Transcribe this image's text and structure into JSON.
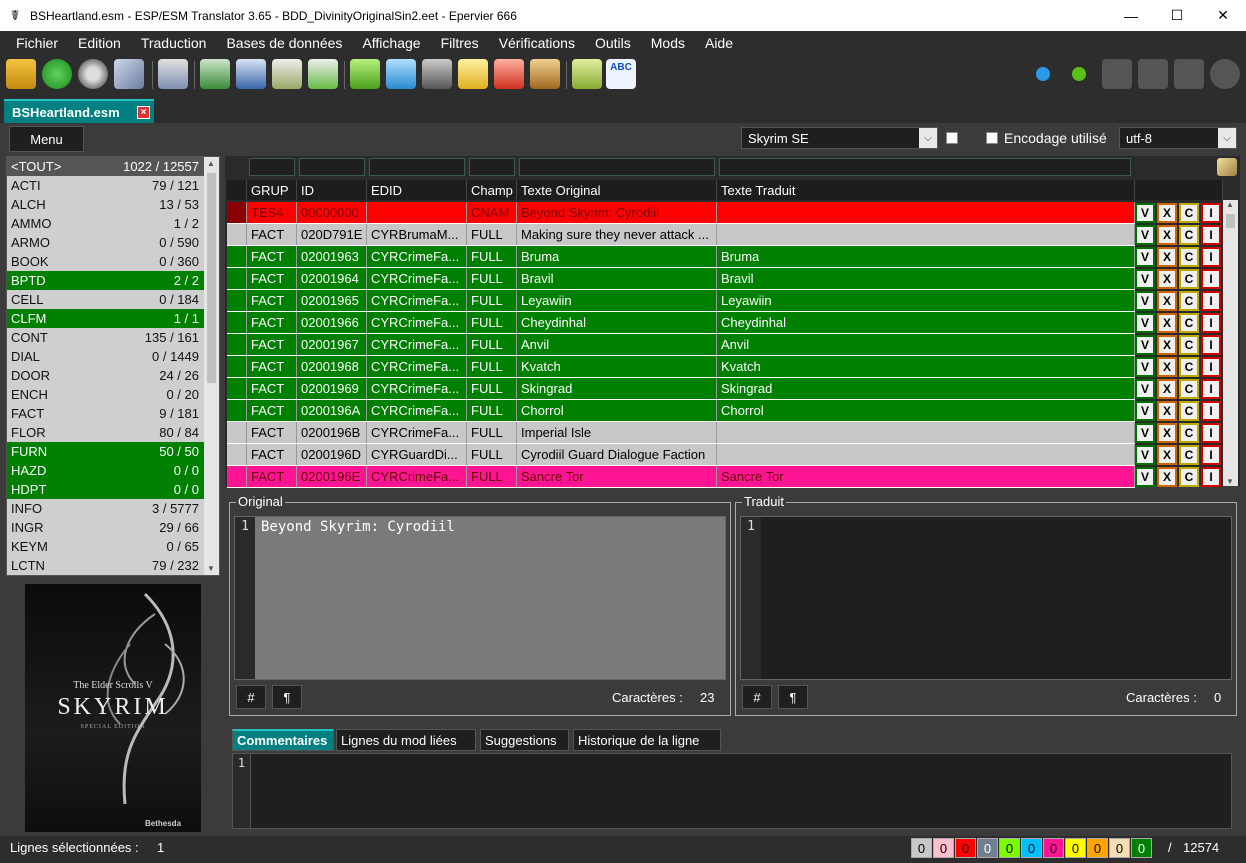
{
  "window": {
    "title": "BSHeartland.esm - ESP/ESM Translator 3.65 - BDD_DivinityOriginalSin2.eet - Epervier 666",
    "minimize": "—",
    "maximize": "☐",
    "close": "✕"
  },
  "menu": [
    "Fichier",
    "Edition",
    "Traduction",
    "Bases de données",
    "Affichage",
    "Filtres",
    "Vérifications",
    "Outils",
    "Mods",
    "Aide"
  ],
  "tab": {
    "label": "BSHeartland.esm",
    "close": "×"
  },
  "menu_button": "Menu",
  "game_select": "Skyrim SE",
  "encoding_label": "Encodage utilisé",
  "encoding_select": "utf-8",
  "left_list": [
    {
      "name": "<TOUT>",
      "count": "1022 / 12557",
      "style": "h"
    },
    {
      "name": "ACTI",
      "count": "79 / 121",
      "style": ""
    },
    {
      "name": "ALCH",
      "count": "13 / 53",
      "style": ""
    },
    {
      "name": "AMMO",
      "count": "1 / 2",
      "style": ""
    },
    {
      "name": "ARMO",
      "count": "0 / 590",
      "style": ""
    },
    {
      "name": "BOOK",
      "count": "0 / 360",
      "style": ""
    },
    {
      "name": "BPTD",
      "count": "2 / 2",
      "style": "g"
    },
    {
      "name": "CELL",
      "count": "0 / 184",
      "style": ""
    },
    {
      "name": "CLFM",
      "count": "1 / 1",
      "style": "g"
    },
    {
      "name": "CONT",
      "count": "135 / 161",
      "style": ""
    },
    {
      "name": "DIAL",
      "count": "0 / 1449",
      "style": ""
    },
    {
      "name": "DOOR",
      "count": "24 / 26",
      "style": ""
    },
    {
      "name": "ENCH",
      "count": "0 / 20",
      "style": ""
    },
    {
      "name": "FACT",
      "count": "9 / 181",
      "style": ""
    },
    {
      "name": "FLOR",
      "count": "80 / 84",
      "style": ""
    },
    {
      "name": "FURN",
      "count": "50 / 50",
      "style": "g"
    },
    {
      "name": "HAZD",
      "count": "0 / 0",
      "style": "g"
    },
    {
      "name": "HDPT",
      "count": "0 / 0",
      "style": "g"
    },
    {
      "name": "INFO",
      "count": "3 / 5777",
      "style": ""
    },
    {
      "name": "INGR",
      "count": "29 / 66",
      "style": ""
    },
    {
      "name": "KEYM",
      "count": "0 / 65",
      "style": ""
    },
    {
      "name": "LCTN",
      "count": "79 / 232",
      "style": ""
    }
  ],
  "cover": {
    "line1": "The Elder Scrolls V",
    "line2": "SKYRIM",
    "line3": "SPECIAL EDITION",
    "brand": "Bethesda"
  },
  "grid": {
    "headers": [
      "GRUP",
      "ID",
      "EDID",
      "Champ",
      "Texte Original",
      "Texte Traduit"
    ],
    "rows": [
      {
        "style": "red",
        "grup": "TES4",
        "id": "00000000",
        "edid": "",
        "champ": "CNAM",
        "orig": "Beyond Skyrim: Cyrodiil",
        "trad": ""
      },
      {
        "style": "gray",
        "grup": "FACT",
        "id": "020D791E",
        "edid": "CYRBrumaM...",
        "champ": "FULL",
        "orig": "Making sure they never attack ...",
        "trad": ""
      },
      {
        "style": "green",
        "grup": "FACT",
        "id": "02001963",
        "edid": "CYRCrimeFa...",
        "champ": "FULL",
        "orig": "Bruma",
        "trad": "Bruma"
      },
      {
        "style": "green",
        "grup": "FACT",
        "id": "02001964",
        "edid": "CYRCrimeFa...",
        "champ": "FULL",
        "orig": "Bravil",
        "trad": "Bravil"
      },
      {
        "style": "green",
        "grup": "FACT",
        "id": "02001965",
        "edid": "CYRCrimeFa...",
        "champ": "FULL",
        "orig": "Leyawiin",
        "trad": "Leyawiin"
      },
      {
        "style": "green",
        "grup": "FACT",
        "id": "02001966",
        "edid": "CYRCrimeFa...",
        "champ": "FULL",
        "orig": "Cheydinhal",
        "trad": "Cheydinhal"
      },
      {
        "style": "green",
        "grup": "FACT",
        "id": "02001967",
        "edid": "CYRCrimeFa...",
        "champ": "FULL",
        "orig": "Anvil",
        "trad": "Anvil"
      },
      {
        "style": "green",
        "grup": "FACT",
        "id": "02001968",
        "edid": "CYRCrimeFa...",
        "champ": "FULL",
        "orig": "Kvatch",
        "trad": "Kvatch"
      },
      {
        "style": "green",
        "grup": "FACT",
        "id": "02001969",
        "edid": "CYRCrimeFa...",
        "champ": "FULL",
        "orig": "Skingrad",
        "trad": "Skingrad"
      },
      {
        "style": "green",
        "grup": "FACT",
        "id": "0200196A",
        "edid": "CYRCrimeFa...",
        "champ": "FULL",
        "orig": "Chorrol",
        "trad": "Chorrol"
      },
      {
        "style": "gray",
        "grup": "FACT",
        "id": "0200196B",
        "edid": "CYRCrimeFa...",
        "champ": "FULL",
        "orig": "Imperial Isle",
        "trad": ""
      },
      {
        "style": "gray",
        "grup": "FACT",
        "id": "0200196D",
        "edid": "CYRGuardDi...",
        "champ": "FULL",
        "orig": "Cyrodiil Guard Dialogue Faction",
        "trad": ""
      },
      {
        "style": "pink",
        "grup": "FACT",
        "id": "0200196E",
        "edid": "CYRCrimeFa...",
        "champ": "FULL",
        "orig": "Sancre Tor",
        "trad": "Sancre Tor"
      }
    ],
    "btn_v": "V",
    "btn_x": "X",
    "btn_c": "C",
    "btn_i": "I"
  },
  "original": {
    "label": "Original",
    "line": "1",
    "text": "Beyond Skyrim: Cyrodiil",
    "chars_label": "Caractères :",
    "chars": "23",
    "btn_hash": "#",
    "btn_para": "¶"
  },
  "traduit": {
    "label": "Traduit",
    "line": "1",
    "text": "",
    "chars_label": "Caractères :",
    "chars": "0",
    "btn_hash": "#",
    "btn_para": "¶"
  },
  "bottom_tabs": [
    "Commentaires",
    "Lignes du mod liées",
    "Suggestions",
    "Historique de la ligne"
  ],
  "comment_line": "1",
  "status": {
    "label": "Lignes sélectionnées :",
    "value": "1",
    "counters": [
      {
        "val": "0",
        "bg": "#c8c8c8",
        "fg": "#000"
      },
      {
        "val": "0",
        "bg": "#ffc0cb",
        "fg": "#000"
      },
      {
        "val": "0",
        "bg": "#ff0000",
        "fg": "#000"
      },
      {
        "val": "0",
        "bg": "#708090",
        "fg": "#fff"
      },
      {
        "val": "0",
        "bg": "#7cfc00",
        "fg": "#000"
      },
      {
        "val": "0",
        "bg": "#00bfff",
        "fg": "#000"
      },
      {
        "val": "0",
        "bg": "#ff1493",
        "fg": "#000"
      },
      {
        "val": "0",
        "bg": "#ffff00",
        "fg": "#000"
      },
      {
        "val": "0",
        "bg": "#ffa500",
        "fg": "#000"
      },
      {
        "val": "0",
        "bg": "#f5deb3",
        "fg": "#000"
      },
      {
        "val": "0",
        "bg": "#008000",
        "fg": "#fff"
      }
    ],
    "slash": "/",
    "total": "12574"
  }
}
